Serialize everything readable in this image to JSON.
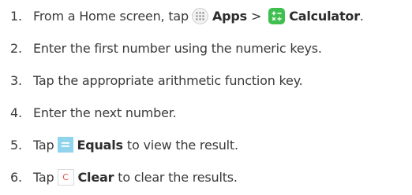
{
  "steps": [
    {
      "num": "1.",
      "text_a": "From a Home screen, tap",
      "apps_label": "Apps",
      "separator": ">",
      "calc_label": "Calculator",
      "suffix": "."
    },
    {
      "num": "2.",
      "text": "Enter the first number using the numeric keys."
    },
    {
      "num": "3.",
      "text": "Tap the appropriate arithmetic function key."
    },
    {
      "num": "4.",
      "text": "Enter the next number."
    },
    {
      "num": "5.",
      "pre": "Tap",
      "bold": "Equals",
      "post": "to view the result."
    },
    {
      "num": "6.",
      "pre": "Tap",
      "icon_glyph": "C",
      "bold": "Clear",
      "post": "to clear the results."
    }
  ],
  "icons": {
    "apps": "apps-grid-icon",
    "calculator": "calculator-icon",
    "equals": "equals-key-icon",
    "clear": "clear-key-icon"
  },
  "colors": {
    "text": "#3a3a3a",
    "calculator_green": "#3fbf4f",
    "equals_blue": "#8fd4ec",
    "clear_red": "#e0543f"
  }
}
